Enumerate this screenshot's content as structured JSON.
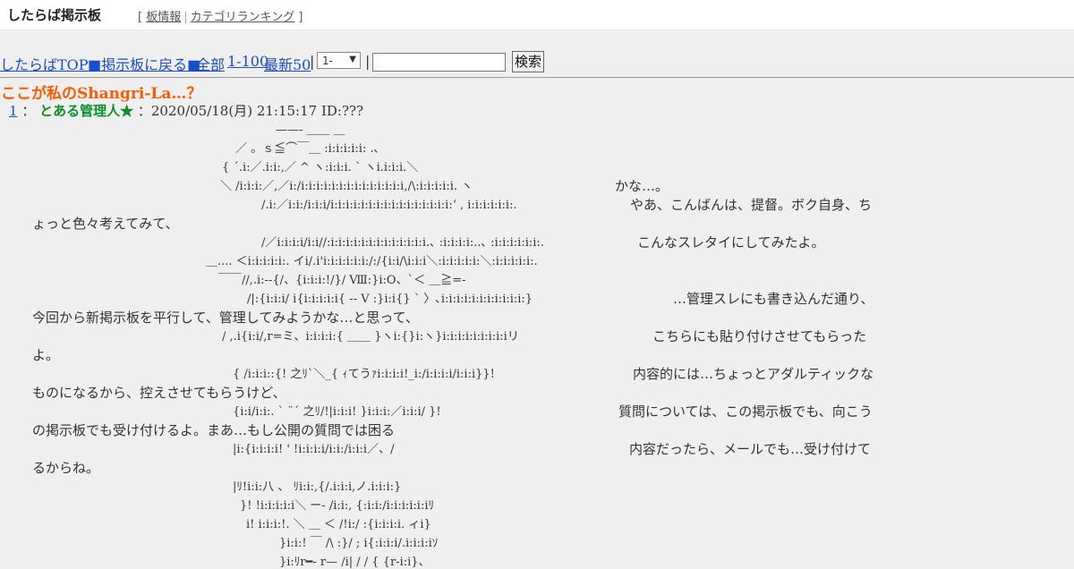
{
  "colors": {
    "accent": "#ff5a00",
    "link": "#1a4ec8",
    "name": "#0b8f28"
  },
  "header": {
    "logo_text": "したらば掲示板",
    "board_info": "板情報",
    "category_ranking": "カテゴリランキング"
  },
  "nav": {
    "top": "したらばTOP",
    "back": "■掲示板に戻る■",
    "all": "全部",
    "range": "1-100",
    "latest": "最新50",
    "select_value": "1-",
    "search_value": "",
    "search_button": "検索"
  },
  "thread": {
    "title": "ここが私のShangri-La…？"
  },
  "post": {
    "number": "1",
    "name": "とある管理人★",
    "date": "2020/05/18(月) 21:15:17 ID:???"
  },
  "aa_lines": [
    "——‐        ＿＿                ＿",
    "／                      。ｓ≦⌒￣＿  :i:i:i:i:i: .､",
    "{                  ´.i:／.i:i:,／ ^ ヽ:i:i:i. ` ヽi.i:i:i.＼",
    "＼      /i:i:i:／,／i:/i:i:i:i:i:i:i:i:i:i:i:i:i:i,/\\:i:i:i:i:i. ヽ",
    "/.i:／i:i:/i:i:i/i:i:i:i:i:i:i:i:i:i:i:i:i:i:i:i:ʻ , i:i:i:i:i:i:.",
    "/／i:i:i:i/i:i//:i:i:i:i:i:i:i:i:i:i:i:i:i.､ :i:i:i:i:..､ :i:i:i:i:i:i:.",
    "＿.... ＜i:i:i:i:i:. イi/.i'i:i:i:i:i:i:/:/{i:i/\\i:i:i＼:i:i:i:i:i:＼:i:i:i:i:i:.",
    "￣￣//,.i:--{/、{i:i:i:!/}/    Ⅷ:}i:O、`＜ ＿≧=-",
    "/|:{i:i:i/        i{i:i:i:i:i{      --  V :}i:i{} ` 〉､i:i:i:i:i:i:i:i:i:i:i:}",
    "/ ,.i{i:i/,r=ミ、i:i:i:i:{     ＿＿   }ヽi:{}i:ヽ}i:i:i:i:i:i:i:i:iリ",
    "{ /i:i:i::{!    之ﾘ`＼_{    ｨてうｧi:i:i:i!_i:/i:i:i:i/i:i:i}}!",
    "{i:i/i:i:.      ` ¨´                    之ﾘ/!|i:i:i! }i:i:i:／i:i:i/ }!",
    "|i:{i:i:i:i!              '                          !i:i:i:i/i:i:/i:i:i／、/",
    "|ﾘ!i:i:八          、                              ﾘi:i:,{/.i:i:i,ノ.i:i:i:}",
    "}! !i:i:i:i:i＼          ー‐               /i:i:, {:i:i:/i:i:i:i:i:iﾘ",
    "i!      i:i:i:!.     ＼          ＿     ＜  /!i:/         :{i:i:i:i. ィi}",
    "}i:i:!            ￣       /\\     :}/ ; i{:i:i:i/.i:i:i:iｿ",
    "}i:ﾘr━-    r— /i|     / /      {     {r-i:i}、"
  ],
  "message_lines": [
    "かな…。",
    "やあ、こんばんは、提督。ボク自身、ち",
    "ょっと色々考えてみて、",
    "こんなスレタイにしてみたよ。",
    "…管理スレにも書き込んだ通り、",
    "今回から新掲示板を平行して、管理してみようかな…と思って、",
    "こちらにも貼り付けさせてもらった",
    "よ。",
    "内容的には…ちょっとアダルティックな",
    "ものになるから、控えさせてもらうけど、",
    "質問については、この掲示板でも、向こう",
    "の掲示板でも受け付けるよ。まあ…もし公開の質問では困る",
    "内容だったら、メールでも…受け付けて",
    "るからね。"
  ]
}
